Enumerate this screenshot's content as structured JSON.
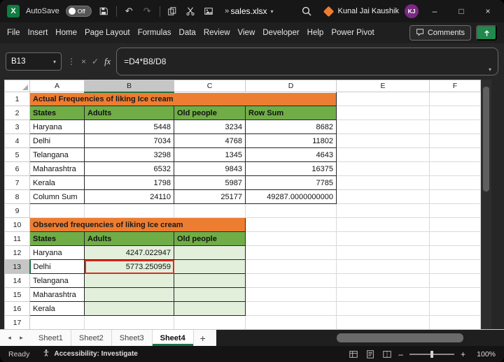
{
  "window": {
    "titlebar": {
      "autosave_label": "AutoSave",
      "autosave_state": "Off",
      "filename": "sales.xlsx",
      "user_name": "Kunal Jai Kaushik",
      "user_initials": "KJ"
    },
    "ribbon_tabs": [
      "File",
      "Insert",
      "Home",
      "Page Layout",
      "Formulas",
      "Data",
      "Review",
      "View",
      "Developer",
      "Help",
      "Power Pivot"
    ],
    "comments_label": "Comments"
  },
  "formula_bar": {
    "name_box_value": "B13",
    "fx_label": "fx",
    "formula": "=D4*B8/D8"
  },
  "grid": {
    "columns": [
      "A",
      "B",
      "C",
      "D",
      "E",
      "F"
    ],
    "selected_column": "B",
    "selected_row": 13,
    "rows": [
      {
        "n": 1,
        "cells": [
          {
            "c": "A",
            "v": "Actual Frequencies of liking Ice cream",
            "cls": "orange tb",
            "span": 4
          }
        ]
      },
      {
        "n": 2,
        "cells": [
          {
            "c": "A",
            "v": "States",
            "cls": "green tb"
          },
          {
            "c": "B",
            "v": "Adults",
            "cls": "green tb"
          },
          {
            "c": "C",
            "v": "Old people",
            "cls": "green tb"
          },
          {
            "c": "D",
            "v": "Row Sum",
            "cls": "green tb"
          }
        ]
      },
      {
        "n": 3,
        "cells": [
          {
            "c": "A",
            "v": "Haryana",
            "cls": "tb"
          },
          {
            "c": "B",
            "v": "5448",
            "cls": "num tb"
          },
          {
            "c": "C",
            "v": "3234",
            "cls": "num tb"
          },
          {
            "c": "D",
            "v": "8682",
            "cls": "num tb"
          }
        ]
      },
      {
        "n": 4,
        "cells": [
          {
            "c": "A",
            "v": "Delhi",
            "cls": "tb"
          },
          {
            "c": "B",
            "v": "7034",
            "cls": "num tb"
          },
          {
            "c": "C",
            "v": "4768",
            "cls": "num tb"
          },
          {
            "c": "D",
            "v": "11802",
            "cls": "num tb"
          }
        ]
      },
      {
        "n": 5,
        "cells": [
          {
            "c": "A",
            "v": "Telangana",
            "cls": "tb"
          },
          {
            "c": "B",
            "v": "3298",
            "cls": "num tb"
          },
          {
            "c": "C",
            "v": "1345",
            "cls": "num tb"
          },
          {
            "c": "D",
            "v": "4643",
            "cls": "num tb"
          }
        ]
      },
      {
        "n": 6,
        "cells": [
          {
            "c": "A",
            "v": "Maharashtra",
            "cls": "tb"
          },
          {
            "c": "B",
            "v": "6532",
            "cls": "num tb"
          },
          {
            "c": "C",
            "v": "9843",
            "cls": "num tb"
          },
          {
            "c": "D",
            "v": "16375",
            "cls": "num tb"
          }
        ]
      },
      {
        "n": 7,
        "cells": [
          {
            "c": "A",
            "v": "Kerala",
            "cls": "tb"
          },
          {
            "c": "B",
            "v": "1798",
            "cls": "num tb"
          },
          {
            "c": "C",
            "v": "5987",
            "cls": "num tb"
          },
          {
            "c": "D",
            "v": "7785",
            "cls": "num tb"
          }
        ]
      },
      {
        "n": 8,
        "cells": [
          {
            "c": "A",
            "v": "Column Sum",
            "cls": "tb"
          },
          {
            "c": "B",
            "v": "24110",
            "cls": "num tb"
          },
          {
            "c": "C",
            "v": "25177",
            "cls": "num tb"
          },
          {
            "c": "D",
            "v": "49287.0000000000",
            "cls": "num tb"
          }
        ]
      },
      {
        "n": 9,
        "cells": []
      },
      {
        "n": 10,
        "cells": [
          {
            "c": "A",
            "v": "Observed frequencies of liking Ice cream",
            "cls": "orange tb",
            "span": 3
          }
        ]
      },
      {
        "n": 11,
        "cells": [
          {
            "c": "A",
            "v": "States",
            "cls": "green tb"
          },
          {
            "c": "B",
            "v": "Adults",
            "cls": "green tb"
          },
          {
            "c": "C",
            "v": "Old people",
            "cls": "green tb"
          }
        ]
      },
      {
        "n": 12,
        "cells": [
          {
            "c": "A",
            "v": "Haryana",
            "cls": "tb"
          },
          {
            "c": "B",
            "v": "4247.022947",
            "cls": "num lg tb"
          },
          {
            "c": "C",
            "v": "",
            "cls": "lg tb"
          }
        ]
      },
      {
        "n": 13,
        "cells": [
          {
            "c": "A",
            "v": "Delhi",
            "cls": "tb"
          },
          {
            "c": "B",
            "v": "5773.250959",
            "cls": "num lg tb selcell"
          },
          {
            "c": "C",
            "v": "",
            "cls": "lg tb"
          }
        ]
      },
      {
        "n": 14,
        "cells": [
          {
            "c": "A",
            "v": "Telangana",
            "cls": "tb"
          },
          {
            "c": "B",
            "v": "",
            "cls": "lg tb"
          },
          {
            "c": "C",
            "v": "",
            "cls": "lg tb"
          }
        ]
      },
      {
        "n": 15,
        "cells": [
          {
            "c": "A",
            "v": "Maharashtra",
            "cls": "tb"
          },
          {
            "c": "B",
            "v": "",
            "cls": "lg tb"
          },
          {
            "c": "C",
            "v": "",
            "cls": "lg tb"
          }
        ]
      },
      {
        "n": 16,
        "cells": [
          {
            "c": "A",
            "v": "Kerala",
            "cls": "tb"
          },
          {
            "c": "B",
            "v": "",
            "cls": "lg tb"
          },
          {
            "c": "C",
            "v": "",
            "cls": "lg tb"
          }
        ]
      },
      {
        "n": 17,
        "cells": []
      }
    ]
  },
  "sheet_tabs": {
    "sheets": [
      "Sheet1",
      "Sheet2",
      "Sheet3",
      "Sheet4"
    ],
    "active": "Sheet4",
    "add_label": "+"
  },
  "status_bar": {
    "mode": "Ready",
    "accessibility": "Accessibility: Investigate",
    "zoom": "100%"
  },
  "icons": {
    "excel_logo": "X",
    "undo": "↶",
    "redo": "↷",
    "overflow": "»",
    "caret_down": "▾",
    "minimize": "–",
    "maximize": "□",
    "close": "×",
    "cancel": "×",
    "enter": "✓",
    "dots": "⋮",
    "prev_sheet": "◂",
    "next_sheet": "▸",
    "zoom_out": "–",
    "zoom_in": "+"
  },
  "colors": {
    "orange": "#ED7D31",
    "green": "#70AD47",
    "light_green": "#E2EFDA",
    "selection_red": "#E02B20",
    "excel_green": "#107C41"
  }
}
